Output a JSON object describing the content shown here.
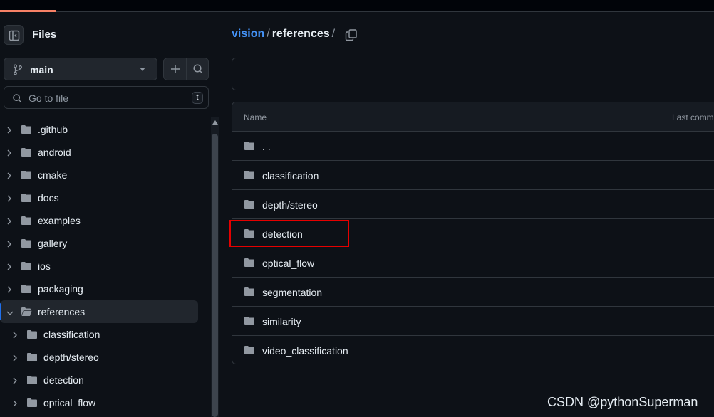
{
  "sidebar": {
    "title": "Files",
    "branch": "main",
    "goto_placeholder": "Go to file",
    "goto_shortcut": "t",
    "tree": [
      {
        "label": ".github",
        "level": 0,
        "expanded": false,
        "active": false
      },
      {
        "label": "android",
        "level": 0,
        "expanded": false,
        "active": false
      },
      {
        "label": "cmake",
        "level": 0,
        "expanded": false,
        "active": false
      },
      {
        "label": "docs",
        "level": 0,
        "expanded": false,
        "active": false
      },
      {
        "label": "examples",
        "level": 0,
        "expanded": false,
        "active": false
      },
      {
        "label": "gallery",
        "level": 0,
        "expanded": false,
        "active": false
      },
      {
        "label": "ios",
        "level": 0,
        "expanded": false,
        "active": false
      },
      {
        "label": "packaging",
        "level": 0,
        "expanded": false,
        "active": false
      },
      {
        "label": "references",
        "level": 0,
        "expanded": true,
        "active": true
      },
      {
        "label": "classification",
        "level": 1,
        "expanded": false,
        "active": false
      },
      {
        "label": "depth/stereo",
        "level": 1,
        "expanded": false,
        "active": false
      },
      {
        "label": "detection",
        "level": 1,
        "expanded": false,
        "active": false
      },
      {
        "label": "optical_flow",
        "level": 1,
        "expanded": false,
        "active": false
      }
    ]
  },
  "breadcrumb": {
    "root": "vision",
    "current": "references",
    "separator": "/"
  },
  "file_table": {
    "col_name": "Name",
    "col_last_commit": "Last comm",
    "rows": [
      {
        "label": ". ."
      },
      {
        "label": "classification"
      },
      {
        "label": "depth/stereo"
      },
      {
        "label": "detection",
        "highlighted": true
      },
      {
        "label": "optical_flow"
      },
      {
        "label": "segmentation"
      },
      {
        "label": "similarity"
      },
      {
        "label": "video_classification"
      }
    ]
  },
  "watermark": "CSDN @pythonSuperman",
  "colors": {
    "background": "#0d1117",
    "link": "#4493f8",
    "highlight_box": "#e60000",
    "active_marker": "#1f6feb"
  }
}
